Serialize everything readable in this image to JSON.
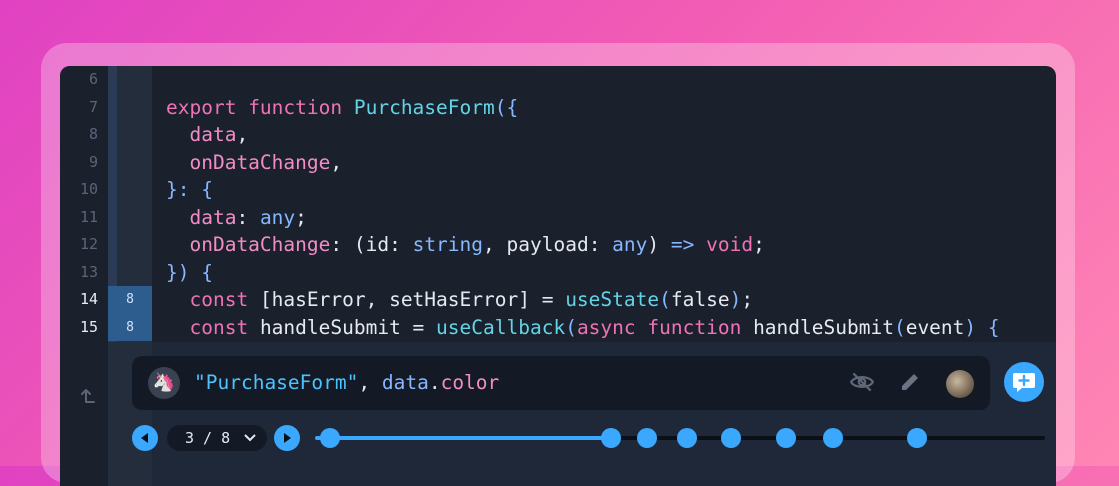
{
  "lines": [
    {
      "num": "6",
      "blame": "",
      "active": false,
      "tokens": []
    },
    {
      "num": "7",
      "blame": "",
      "active": false,
      "tokens": [
        {
          "c": "kw",
          "t": "export "
        },
        {
          "c": "kw",
          "t": "function "
        },
        {
          "c": "fn",
          "t": "PurchaseForm"
        },
        {
          "c": "ty",
          "t": "({"
        }
      ]
    },
    {
      "num": "8",
      "blame": "",
      "active": false,
      "tokens": [
        {
          "c": "pl",
          "t": "  "
        },
        {
          "c": "pr",
          "t": "data"
        },
        {
          "c": "pl",
          "t": ","
        }
      ]
    },
    {
      "num": "9",
      "blame": "",
      "active": false,
      "tokens": [
        {
          "c": "pl",
          "t": "  "
        },
        {
          "c": "pr",
          "t": "onDataChange"
        },
        {
          "c": "pl",
          "t": ","
        }
      ]
    },
    {
      "num": "10",
      "blame": "",
      "active": false,
      "tokens": [
        {
          "c": "ty",
          "t": "}: {"
        }
      ]
    },
    {
      "num": "11",
      "blame": "",
      "active": false,
      "tokens": [
        {
          "c": "pl",
          "t": "  "
        },
        {
          "c": "pr",
          "t": "data"
        },
        {
          "c": "pl",
          "t": ": "
        },
        {
          "c": "ty",
          "t": "any"
        },
        {
          "c": "pl",
          "t": ";"
        }
      ]
    },
    {
      "num": "12",
      "blame": "",
      "active": false,
      "tokens": [
        {
          "c": "pl",
          "t": "  "
        },
        {
          "c": "pr",
          "t": "onDataChange"
        },
        {
          "c": "pl",
          "t": ": ("
        },
        {
          "c": "pl",
          "t": "id"
        },
        {
          "c": "pl",
          "t": ": "
        },
        {
          "c": "ty",
          "t": "string"
        },
        {
          "c": "pl",
          "t": ", payload: "
        },
        {
          "c": "ty",
          "t": "any"
        },
        {
          "c": "pl",
          "t": ") "
        },
        {
          "c": "ty",
          "t": "=>"
        },
        {
          "c": "pl",
          "t": " "
        },
        {
          "c": "kw",
          "t": "void"
        },
        {
          "c": "pl",
          "t": ";"
        }
      ]
    },
    {
      "num": "13",
      "blame": "",
      "active": false,
      "tokens": [
        {
          "c": "ty",
          "t": "}) {"
        }
      ]
    },
    {
      "num": "14",
      "blame": "8",
      "active": true,
      "tokens": [
        {
          "c": "pl",
          "t": "  "
        },
        {
          "c": "kw",
          "t": "const "
        },
        {
          "c": "pl",
          "t": "[hasError, setHasError] = "
        },
        {
          "c": "fn",
          "t": "useState"
        },
        {
          "c": "ty",
          "t": "("
        },
        {
          "c": "pl",
          "t": "false"
        },
        {
          "c": "ty",
          "t": ")"
        },
        {
          "c": "pl",
          "t": ";"
        }
      ]
    },
    {
      "num": "15",
      "blame": "8",
      "active": true,
      "tokens": [
        {
          "c": "pl",
          "t": "  "
        },
        {
          "c": "kw",
          "t": "const "
        },
        {
          "c": "pl",
          "t": "handleSubmit = "
        },
        {
          "c": "fn",
          "t": "useCallback"
        },
        {
          "c": "ty",
          "t": "("
        },
        {
          "c": "kw",
          "t": "async "
        },
        {
          "c": "kw",
          "t": "function "
        },
        {
          "c": "pl",
          "t": "handleSubmit"
        },
        {
          "c": "ty",
          "t": "("
        },
        {
          "c": "pl",
          "t": "event"
        },
        {
          "c": "ty",
          "t": ") {"
        }
      ]
    }
  ],
  "expression": {
    "parts": [
      {
        "c": "st",
        "t": "\"PurchaseForm\""
      },
      {
        "c": "pl",
        "t": ", "
      },
      {
        "c": "ty",
        "t": "data"
      },
      {
        "c": "pl",
        "t": "."
      },
      {
        "c": "pr",
        "t": "color"
      }
    ]
  },
  "icons": {
    "unicorn_avatar": "unicorn-avatar",
    "hide": "eye-off-icon",
    "edit": "pencil-icon",
    "user_avatar": "user-avatar",
    "comment": "add-comment-icon",
    "collapse": "collapse-up-icon",
    "prev": "play-left-icon",
    "next": "play-right-icon",
    "chevron": "chevron-down-icon"
  },
  "timeline": {
    "counter": "3 / 8",
    "progress_fraction": 0.405,
    "markers": [
      0.02,
      0.405,
      0.455,
      0.51,
      0.57,
      0.645,
      0.71,
      0.825
    ]
  },
  "colors": {
    "accent": "#3aa8ff",
    "editor_bg": "#1a212d",
    "active_blame": "#2d5d8e"
  }
}
